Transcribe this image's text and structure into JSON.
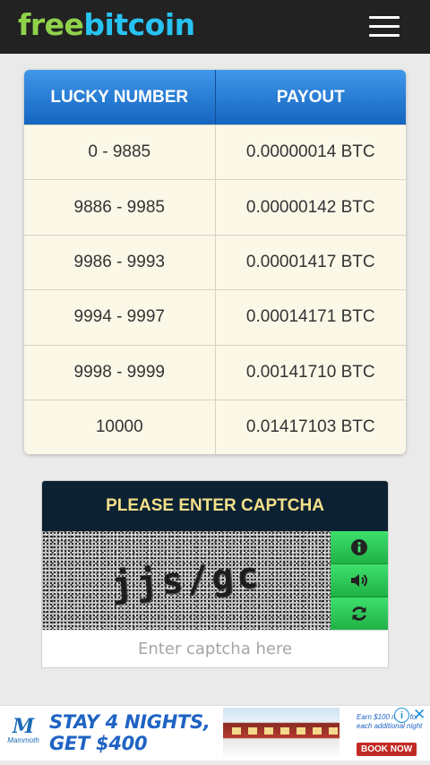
{
  "header": {
    "logo_part1": "free",
    "logo_part2": "bitcoin",
    "logo_colors": {
      "free": "#8fd24a",
      "bitcoin": "#27c3f3"
    },
    "menu_icon": "hamburger-menu-icon"
  },
  "payout_table": {
    "headers": [
      "LUCKY NUMBER",
      "PAYOUT"
    ],
    "rows": [
      {
        "lucky_number": "0 - 9885",
        "payout": "0.00000014 BTC"
      },
      {
        "lucky_number": "9886 - 9985",
        "payout": "0.00000142 BTC"
      },
      {
        "lucky_number": "9986 - 9993",
        "payout": "0.00001417 BTC"
      },
      {
        "lucky_number": "9994 - 9997",
        "payout": "0.00014171 BTC"
      },
      {
        "lucky_number": "9998 - 9999",
        "payout": "0.00141710 BTC"
      },
      {
        "lucky_number": "10000",
        "payout": "0.01417103 BTC"
      }
    ]
  },
  "captcha": {
    "title": "PLEASE ENTER CAPTCHA",
    "image_text": "jjs/gc",
    "input_placeholder": "Enter captcha here",
    "input_value": "",
    "tools": [
      "info-icon",
      "speaker-icon",
      "refresh-icon"
    ],
    "accent": "#27c24f"
  },
  "ad": {
    "brand": "Mammoth",
    "headline_line1": "STAY 4 NIGHTS,",
    "headline_line2": "GET $400",
    "small_text": "Earn $100 more for each additional night",
    "cta": "BOOK NOW",
    "info": "i",
    "close": "✕"
  }
}
